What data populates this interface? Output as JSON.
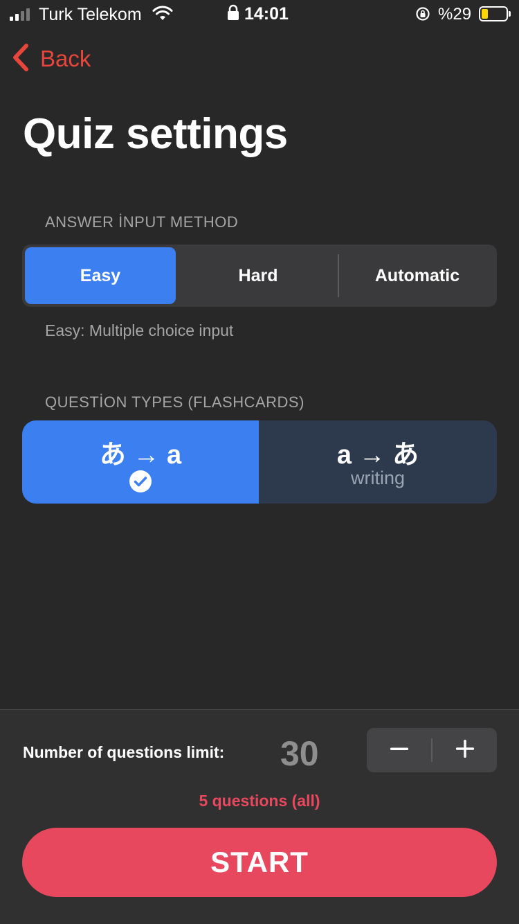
{
  "status_bar": {
    "carrier": "Turk Telekom",
    "time": "14:01",
    "battery": "%29",
    "battery_color": "#ffd400"
  },
  "nav": {
    "back_label": "Back"
  },
  "page": {
    "title": "Quiz settings"
  },
  "answer_input": {
    "section_label": "ANSWER İNPUT METHOD",
    "options": [
      "Easy",
      "Hard",
      "Automatic"
    ],
    "selected": "Easy",
    "hint": "Easy: Multiple choice input"
  },
  "question_types": {
    "section_label": "QUESTİON TYPES (FLASHCARDS)",
    "items": [
      {
        "label": "あ → a",
        "selected": true,
        "icon": "check-circle-icon"
      },
      {
        "label": "a → あ",
        "sublabel": "writing",
        "selected": false
      }
    ]
  },
  "limit": {
    "label": "Number of questions limit:",
    "value": "30",
    "note": "5 questions (all)"
  },
  "start_label": "START",
  "colors": {
    "accent_blue": "#3b7ff0",
    "accent_red": "#e8485e",
    "back_red": "#e8463c",
    "background": "#282828"
  }
}
